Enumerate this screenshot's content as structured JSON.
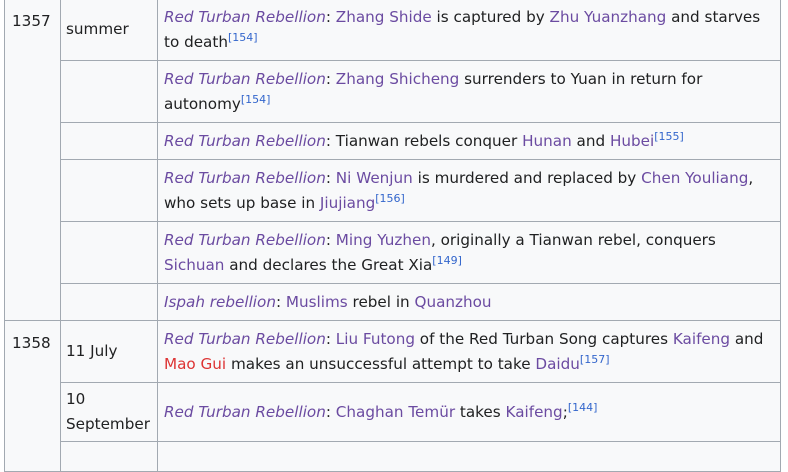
{
  "rows": [
    {
      "year": "1357",
      "date": "summer",
      "pre": "",
      "topic": "Red Turban Rebellion",
      "sep": ": ",
      "parts": [
        {
          "t": "link",
          "v": "Zhang Shide"
        },
        {
          "t": "text",
          "v": " is captured by "
        },
        {
          "t": "link",
          "v": "Zhu Yuanzhang"
        },
        {
          "t": "text",
          "v": " and starves to death"
        },
        {
          "t": "ref",
          "v": "[154]"
        }
      ]
    },
    {
      "topic": "Red Turban Rebellion",
      "sep": ": ",
      "parts": [
        {
          "t": "link",
          "v": "Zhang Shicheng"
        },
        {
          "t": "text",
          "v": " surrenders to Yuan in return for autonomy"
        },
        {
          "t": "ref",
          "v": "[154]"
        }
      ]
    },
    {
      "topic": "Red Turban Rebellion",
      "sep": ": ",
      "parts": [
        {
          "t": "text",
          "v": "Tianwan rebels conquer "
        },
        {
          "t": "link",
          "v": "Hunan"
        },
        {
          "t": "text",
          "v": " and "
        },
        {
          "t": "link",
          "v": "Hubei"
        },
        {
          "t": "ref",
          "v": "[155]"
        }
      ]
    },
    {
      "topic": "Red Turban Rebellion",
      "sep": ": ",
      "parts": [
        {
          "t": "link",
          "v": "Ni Wenjun"
        },
        {
          "t": "text",
          "v": " is murdered and replaced by "
        },
        {
          "t": "link",
          "v": "Chen Youliang"
        },
        {
          "t": "text",
          "v": ", who sets up base in "
        },
        {
          "t": "link",
          "v": "Jiujiang"
        },
        {
          "t": "ref",
          "v": "[156]"
        }
      ]
    },
    {
      "topic": "Red Turban Rebellion",
      "sep": ": ",
      "parts": [
        {
          "t": "link",
          "v": "Ming Yuzhen"
        },
        {
          "t": "text",
          "v": ", originally a Tianwan rebel, conquers "
        },
        {
          "t": "link",
          "v": "Sichuan"
        },
        {
          "t": "text",
          "v": " and declares the Great Xia"
        },
        {
          "t": "ref",
          "v": "[149]"
        }
      ]
    },
    {
      "topic": "Ispah rebellion",
      "sep": ": ",
      "parts": [
        {
          "t": "link",
          "v": "Muslims"
        },
        {
          "t": "text",
          "v": " rebel in "
        },
        {
          "t": "link",
          "v": "Quanzhou"
        }
      ]
    },
    {
      "year": "1358",
      "date": "11 July",
      "topic": "Red Turban Rebellion",
      "sep": ": ",
      "parts": [
        {
          "t": "link",
          "v": "Liu Futong"
        },
        {
          "t": "text",
          "v": " of the Red Turban Song captures "
        },
        {
          "t": "link",
          "v": "Kaifeng"
        },
        {
          "t": "text",
          "v": " and "
        },
        {
          "t": "red",
          "v": "Mao Gui"
        },
        {
          "t": "text",
          "v": " makes an unsuccessful attempt to take "
        },
        {
          "t": "link",
          "v": "Daidu"
        },
        {
          "t": "ref",
          "v": "[157]"
        }
      ]
    },
    {
      "date": "10 September",
      "topic": "Red Turban Rebellion",
      "sep": ": ",
      "parts": [
        {
          "t": "link",
          "v": "Chaghan Temür"
        },
        {
          "t": "text",
          "v": " takes "
        },
        {
          "t": "link",
          "v": "Kaifeng"
        },
        {
          "t": "text",
          "v": ";"
        },
        {
          "t": "ref",
          "v": "[144]"
        }
      ]
    }
  ]
}
